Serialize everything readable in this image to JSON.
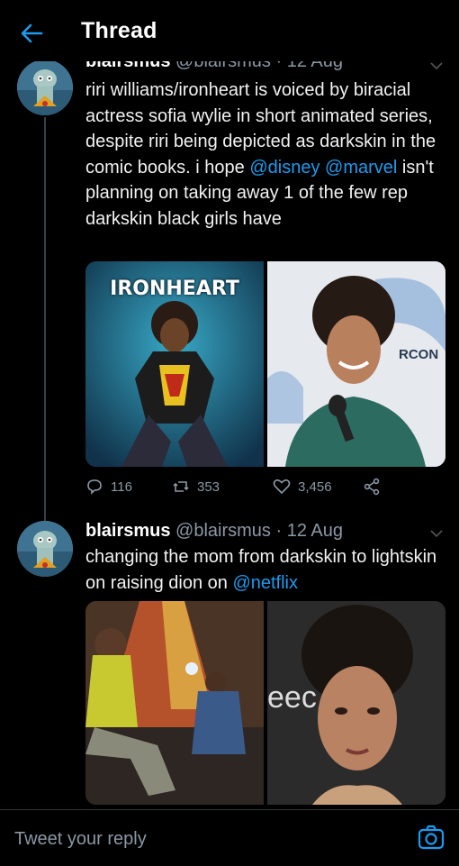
{
  "header": {
    "title": "Thread",
    "back_icon": "arrow-left-icon"
  },
  "tweets": [
    {
      "display_name": "blairsmus",
      "handle": "@blairsmus",
      "time": "· 12 Aug",
      "text_parts": [
        "riri williams/ironheart is voiced by biracial actress sofia wylie in short animated series, despite riri being depicted as darkskin in the comic books. i hope ",
        "@disney",
        " ",
        "@marvel",
        " isn't planning on taking away 1 of the few rep darkskin black girls have"
      ],
      "media": {
        "left_title": "IRONHEART",
        "right_banner": "RCON"
      },
      "stats": {
        "replies": "116",
        "retweets": "353",
        "likes": "3,456"
      }
    },
    {
      "display_name": "blairsmus",
      "handle": "@blairsmus",
      "time": "· 12 Aug",
      "text_parts": [
        "changing the mom from darkskin to lightskin on raising dion on ",
        "@netflix"
      ],
      "media": {
        "right_banner": "eec"
      }
    }
  ],
  "reply_bar": {
    "placeholder": "Tweet your reply",
    "icon": "camera-icon"
  },
  "colors": {
    "background": "#000000",
    "accent": "#1d9bf0",
    "muted": "#8b98a5"
  }
}
